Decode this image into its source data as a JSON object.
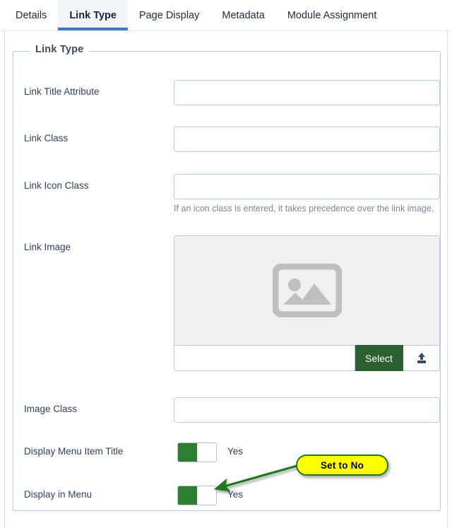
{
  "tabs": [
    {
      "label": "Details",
      "active": false
    },
    {
      "label": "Link Type",
      "active": true
    },
    {
      "label": "Page Display",
      "active": false
    },
    {
      "label": "Metadata",
      "active": false
    },
    {
      "label": "Module Assignment",
      "active": false
    }
  ],
  "fieldset": {
    "legend": "Link Type"
  },
  "fields": {
    "link_title_attribute": {
      "label": "Link Title Attribute",
      "value": "",
      "placeholder": ""
    },
    "link_class": {
      "label": "Link Class",
      "value": "",
      "placeholder": ""
    },
    "link_icon_class": {
      "label": "Link Icon Class",
      "value": "",
      "placeholder": "",
      "help": "If an icon class is entered, it takes precedence over the link image."
    },
    "link_image": {
      "label": "Link Image",
      "value": "",
      "placeholder": "",
      "placeholder_icon": "image-placeholder-icon",
      "select_label": "Select",
      "upload_icon": "upload-icon"
    },
    "image_class": {
      "label": "Image Class",
      "value": "",
      "placeholder": ""
    },
    "display_menu_item_title": {
      "label": "Display Menu Item Title",
      "state": "Yes"
    },
    "display_in_menu": {
      "label": "Display in Menu",
      "state": "Yes"
    }
  },
  "annotation": {
    "callout_text": "Set to No",
    "callout_fill": "#ffff00",
    "callout_border": "#1c7a1c",
    "arrow_color": "#1c7a1c"
  },
  "colors": {
    "active_tab_underline": "#4478be",
    "active_tab_bg": "#f2f5f9",
    "input_border": "#b8cce0",
    "select_button": "#2d6030",
    "toggle_on": "#2e7d32",
    "label_text": "#2f4260",
    "help_text": "#7d8896"
  }
}
